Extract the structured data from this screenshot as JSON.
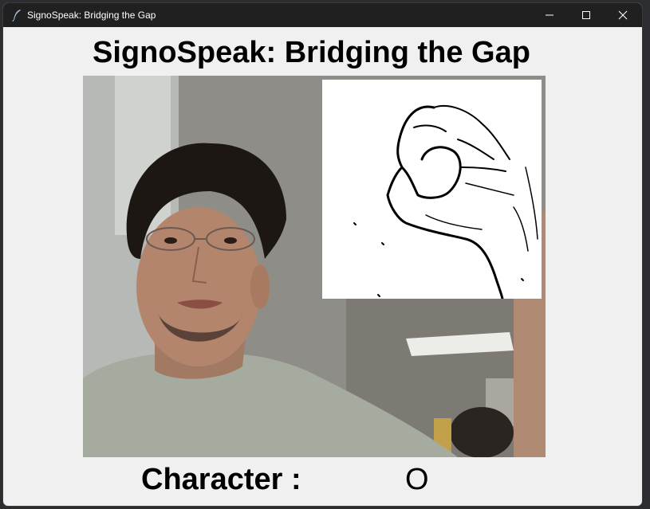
{
  "window": {
    "title": "SignoSpeak: Bridging the Gap",
    "controls": {
      "minimize_icon": "minimize-icon",
      "maximize_icon": "maximize-icon",
      "close_icon": "close-icon"
    }
  },
  "main": {
    "heading": "SignoSpeak: Bridging the Gap",
    "character_label": "Character :",
    "character_value": "O"
  },
  "colors": {
    "titlebar": "#202020",
    "window_background": "#f0f0f0",
    "text": "#000000"
  }
}
